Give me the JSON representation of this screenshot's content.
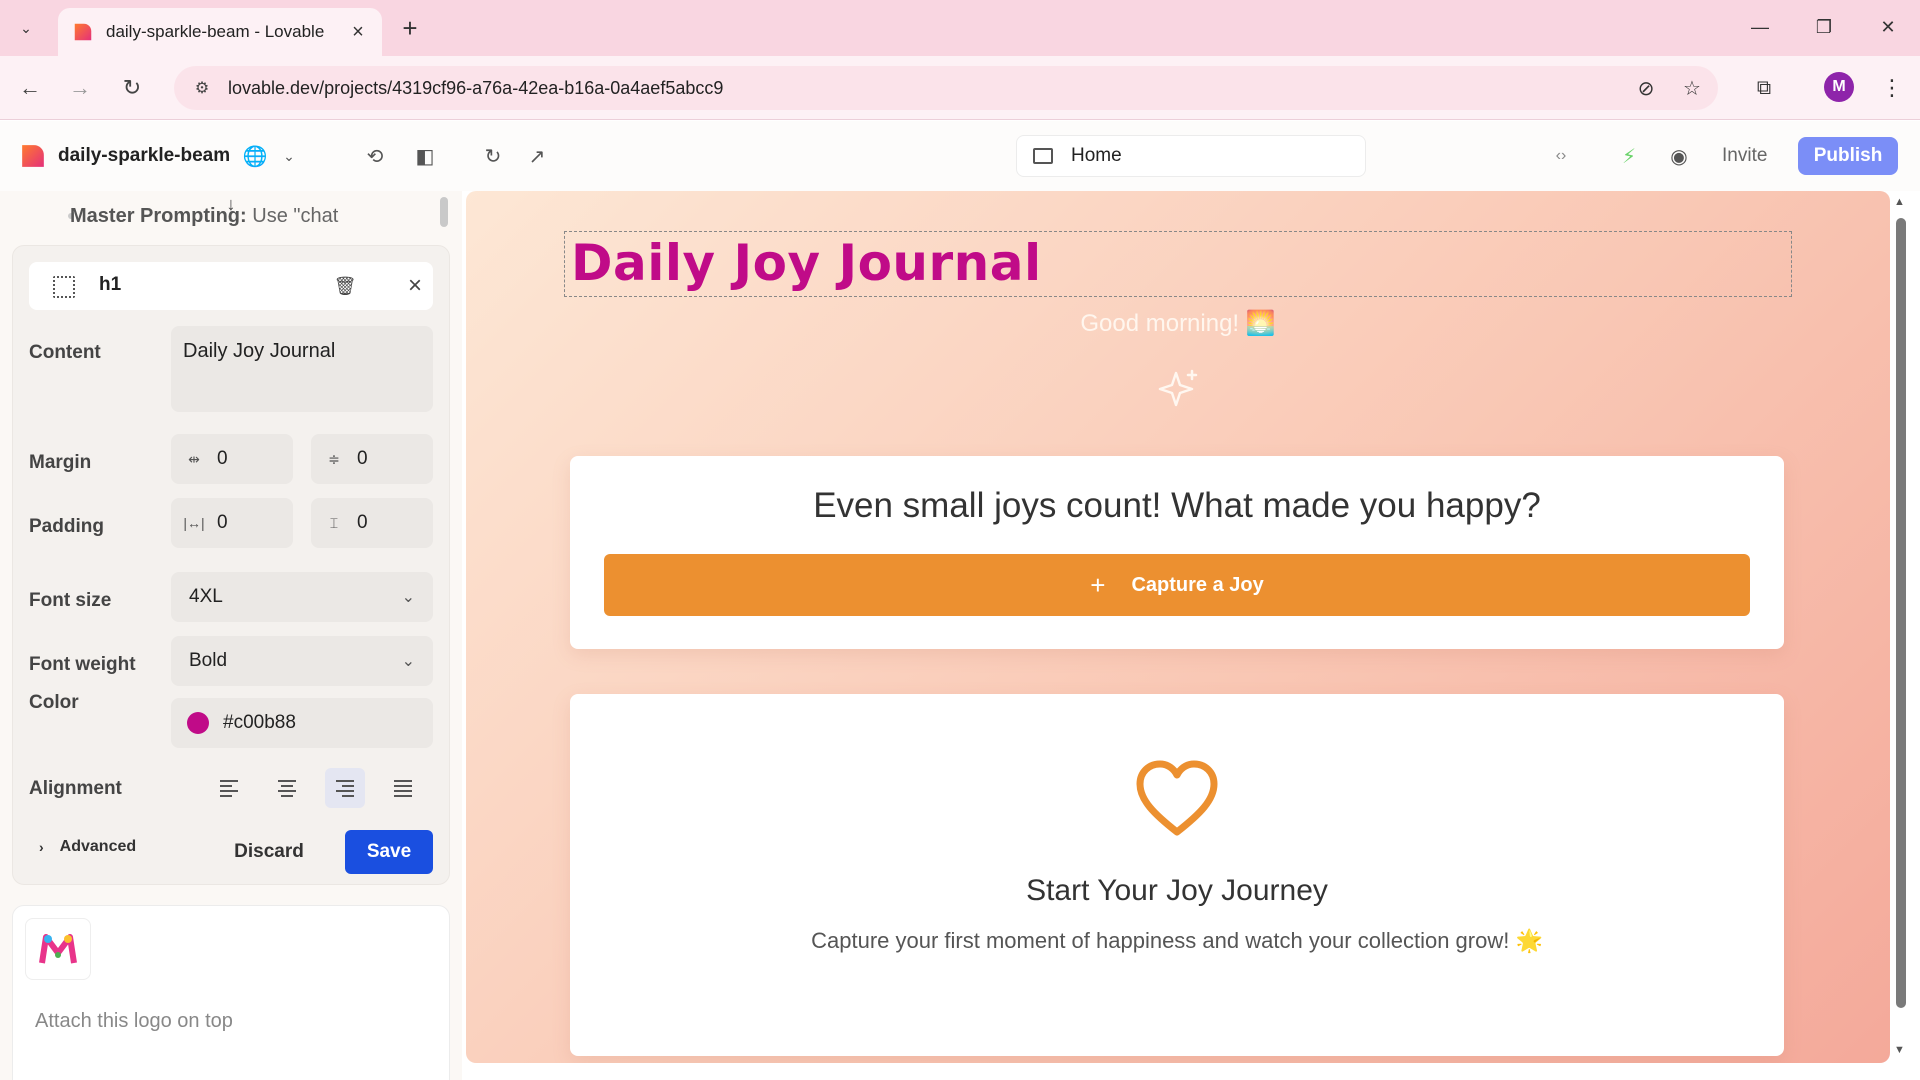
{
  "browser": {
    "tab_title": "daily-sparkle-beam - Lovable",
    "url": "lovable.dev/projects/4319cf96-a76a-42ea-b16a-0a4aef5abcc9",
    "profile_initial": "M"
  },
  "app": {
    "project_name": "daily-sparkle-beam",
    "route": "Home",
    "invite_label": "Invite",
    "publish_label": "Publish"
  },
  "chat": {
    "master_bold": "Master Prompting:",
    "master_rest": " Use \"chat"
  },
  "editor": {
    "element_tag": "h1",
    "content_label": "Content",
    "content_value": "Daily Joy Journal",
    "margin_label": "Margin",
    "margin_x": "0",
    "margin_y": "0",
    "padding_label": "Padding",
    "padding_x": "0",
    "padding_y": "0",
    "font_size_label": "Font size",
    "font_size_value": "4XL",
    "font_weight_label": "Font weight",
    "font_weight_value": "Bold",
    "color_label": "Color",
    "color_value": "#c00b88",
    "alignment_label": "Alignment",
    "alignment_selected": "right",
    "advanced_label": "Advanced",
    "discard_label": "Discard",
    "save_label": "Save"
  },
  "attachment": {
    "text": "Attach this logo on top"
  },
  "preview": {
    "heading": "Daily Joy Journal",
    "greeting": "Good morning! 🌅",
    "card1_title": "Even small joys count! What made you happy?",
    "capture_label": "Capture a Joy",
    "card2_title": "Start Your Joy Journey",
    "card2_subtitle": "Capture your first moment of happiness and watch your collection grow! 🌟"
  },
  "colors": {
    "heading": "#c00b88",
    "capture_button": "#ec9030",
    "publish_button": "#7b8ef7",
    "save_button": "#1a4fe0",
    "heart": "#ec9030"
  }
}
